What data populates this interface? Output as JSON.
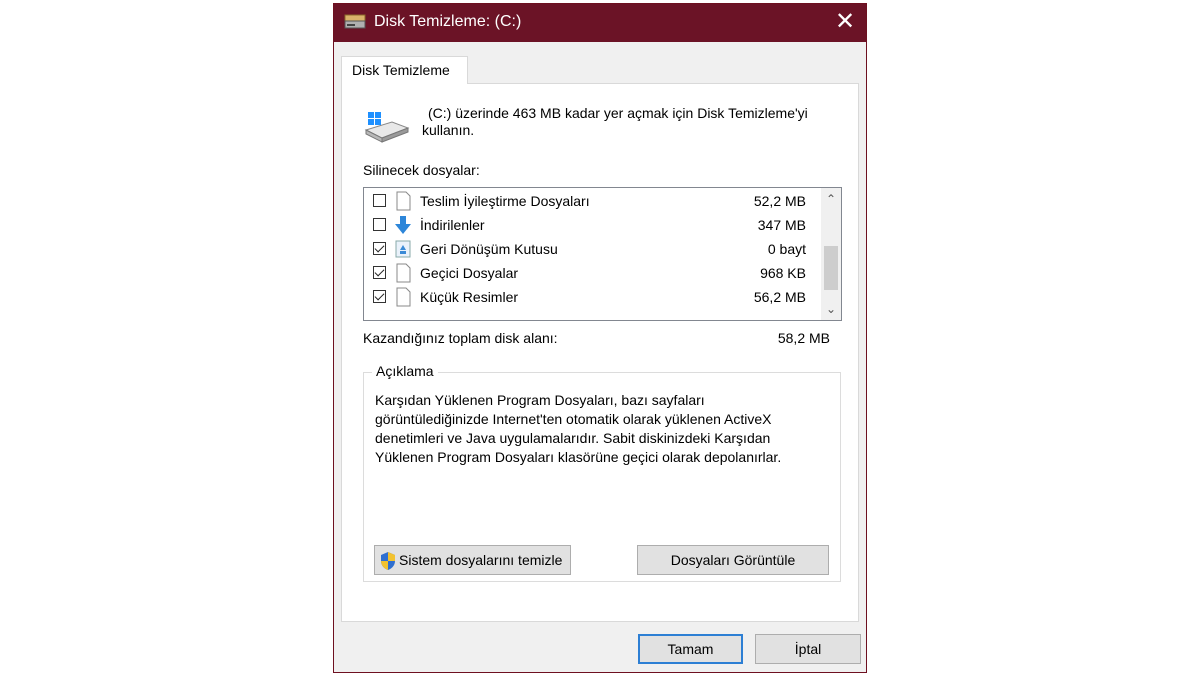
{
  "window": {
    "title": "Disk Temizleme:  (C:)",
    "close_glyph": "✕",
    "title_icon": "disk-cleanup-icon",
    "colors": {
      "titlebar": "#6b1326",
      "accent": "#2d7fd4"
    }
  },
  "tab": {
    "label": "Disk Temizleme"
  },
  "intro": {
    "line1": "(C:) üzerinde 463 MB kadar yer açmak için Disk Temizleme'yi",
    "line2": "kullanın."
  },
  "files": {
    "label": "Silinecek dosyalar:",
    "items": [
      {
        "name": "Teslim İyileştirme Dosyaları",
        "size": "52,2 MB",
        "checked": false,
        "icon": "file-icon"
      },
      {
        "name": "İndirilenler",
        "size": "347 MB",
        "checked": false,
        "icon": "download-arrow-icon"
      },
      {
        "name": "Geri Dönüşüm Kutusu",
        "size": "0 bayt",
        "checked": true,
        "icon": "recycle-bin-icon"
      },
      {
        "name": "Geçici Dosyalar",
        "size": "968 KB",
        "checked": true,
        "icon": "file-icon"
      },
      {
        "name": "Küçük Resimler",
        "size": "56,2 MB",
        "checked": true,
        "icon": "file-icon"
      }
    ],
    "scroll_up_glyph": "⌃",
    "scroll_down_glyph": "⌄"
  },
  "total": {
    "label": "Kazandığınız toplam disk alanı:",
    "value": "58,2 MB"
  },
  "description": {
    "label": "Açıklama",
    "line1": "Karşıdan Yüklenen Program Dosyaları, bazı sayfaları",
    "line2": "görüntülediğinizde Internet'ten otomatik olarak yüklenen ActiveX",
    "line3": "denetimleri ve Java uygulamalarıdır. Sabit diskinizdeki Karşıdan",
    "line4": "Yüklenen Program Dosyaları klasörüne geçici olarak depolanırlar."
  },
  "buttons": {
    "system_clean": "Sistem dosyalarını temizle",
    "view_files": "Dosyaları Görüntüle",
    "ok": "Tamam",
    "cancel": "İptal"
  }
}
